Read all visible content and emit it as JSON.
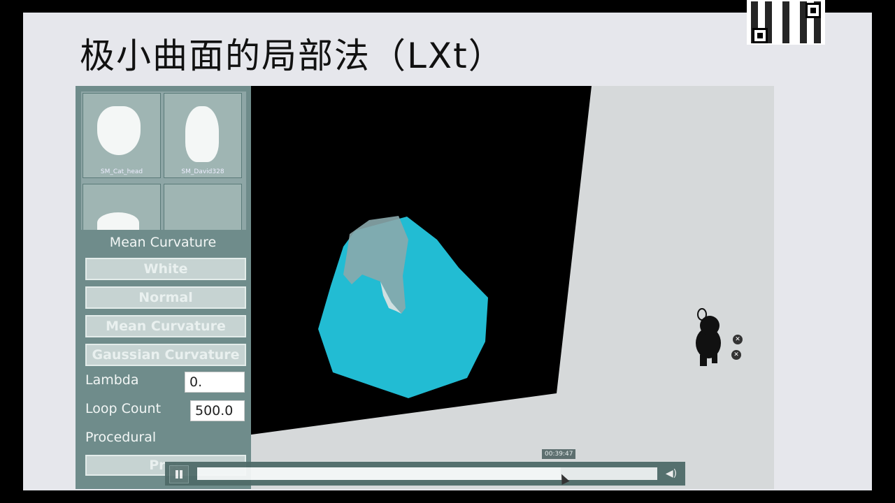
{
  "slide": {
    "title": "极小曲面的局部法（LXt）"
  },
  "panel": {
    "thumbnails": [
      {
        "label": "SM_Cat_head"
      },
      {
        "label": "SM_David328"
      }
    ],
    "section_title": "Mean Curvature",
    "buttons": [
      {
        "label": "White"
      },
      {
        "label": "Normal"
      },
      {
        "label": "Mean Curvature"
      },
      {
        "label": "Gaussian Curvature"
      }
    ],
    "lambda": {
      "label": "Lambda",
      "value": "0."
    },
    "loop_count": {
      "label": "Loop Count",
      "value": "500.0"
    },
    "procedural": {
      "label": "Procedural"
    },
    "process_button": {
      "label": "Proc"
    }
  },
  "player": {
    "timestamp": "00:39:47",
    "progress": 0.79
  },
  "colors": {
    "mesh": "#22bcd3",
    "panel": "#6f8c8b",
    "viewport_bg": "#000000"
  }
}
